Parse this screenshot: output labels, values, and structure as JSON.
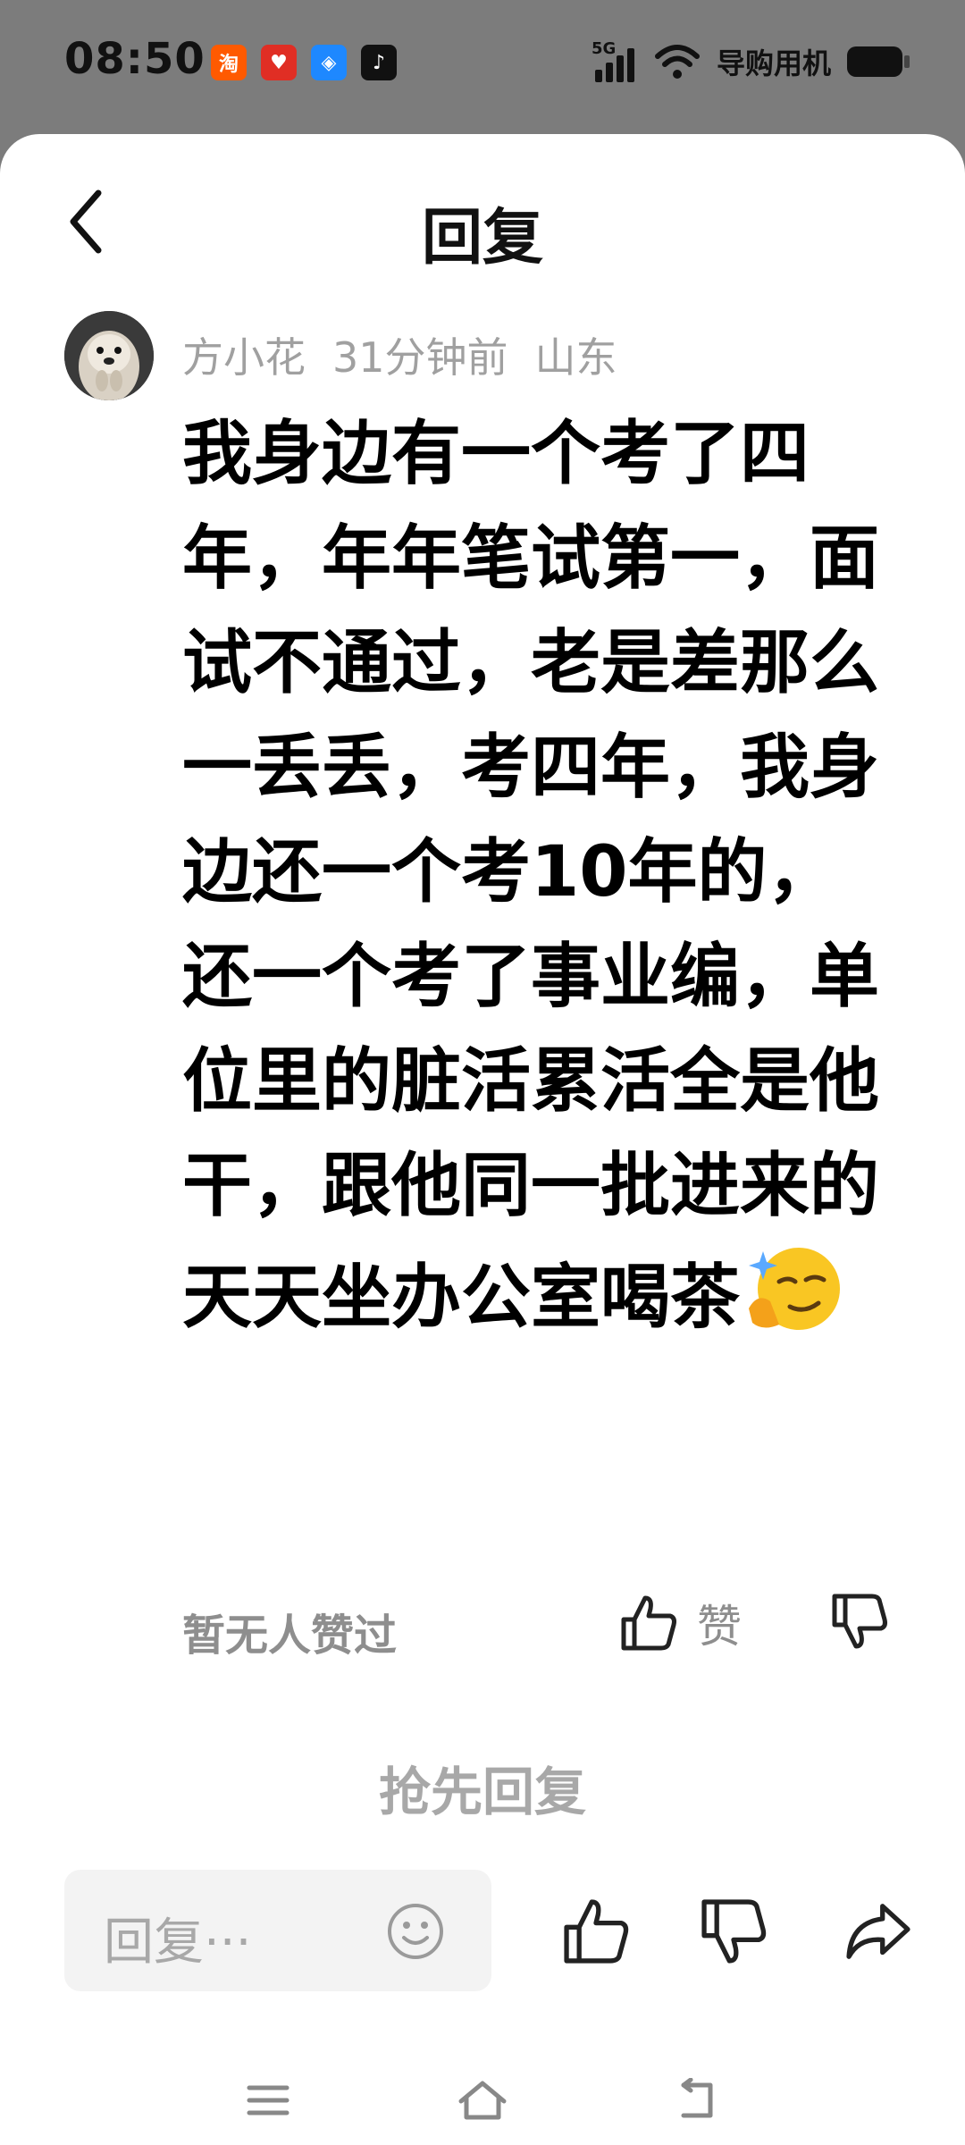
{
  "status_bar": {
    "time": "08:50",
    "network": "5G",
    "carrier": "导购用机",
    "app_icons": [
      {
        "name": "taobao-icon",
        "glyph": "淘",
        "color": "#ff5a00"
      },
      {
        "name": "pinduoduo-icon",
        "glyph": "♥",
        "color": "#e02e24"
      },
      {
        "name": "blue-app-icon",
        "glyph": "◈",
        "color": "#1e88ff"
      },
      {
        "name": "douyin-icon",
        "glyph": "♪",
        "color": "#111111"
      }
    ]
  },
  "header": {
    "title": "回复"
  },
  "comment": {
    "author": "方小花",
    "time_ago": "31分钟前",
    "location": "山东",
    "text": "我身边有一个考了四年，年年笔试第一，面试不通过，老是差那么一丢丢，考四年，我身边还一个考10年的，还一个考了事业编，单位里的脏活累活全是他干，跟他同一批进来的天天坐办公室喝茶",
    "emoji": "smirk-thinking-emoji"
  },
  "likes": {
    "count_text": "暂无人赞过",
    "like_label": "赞"
  },
  "first_reply_label": "抢先回复",
  "reply_bar": {
    "placeholder": "回复···"
  },
  "colors": {
    "background_dim": "#7c7c7c",
    "sheet": "#ffffff",
    "muted_text": "#a0a0a0",
    "input_bg": "#f3f3f3"
  }
}
